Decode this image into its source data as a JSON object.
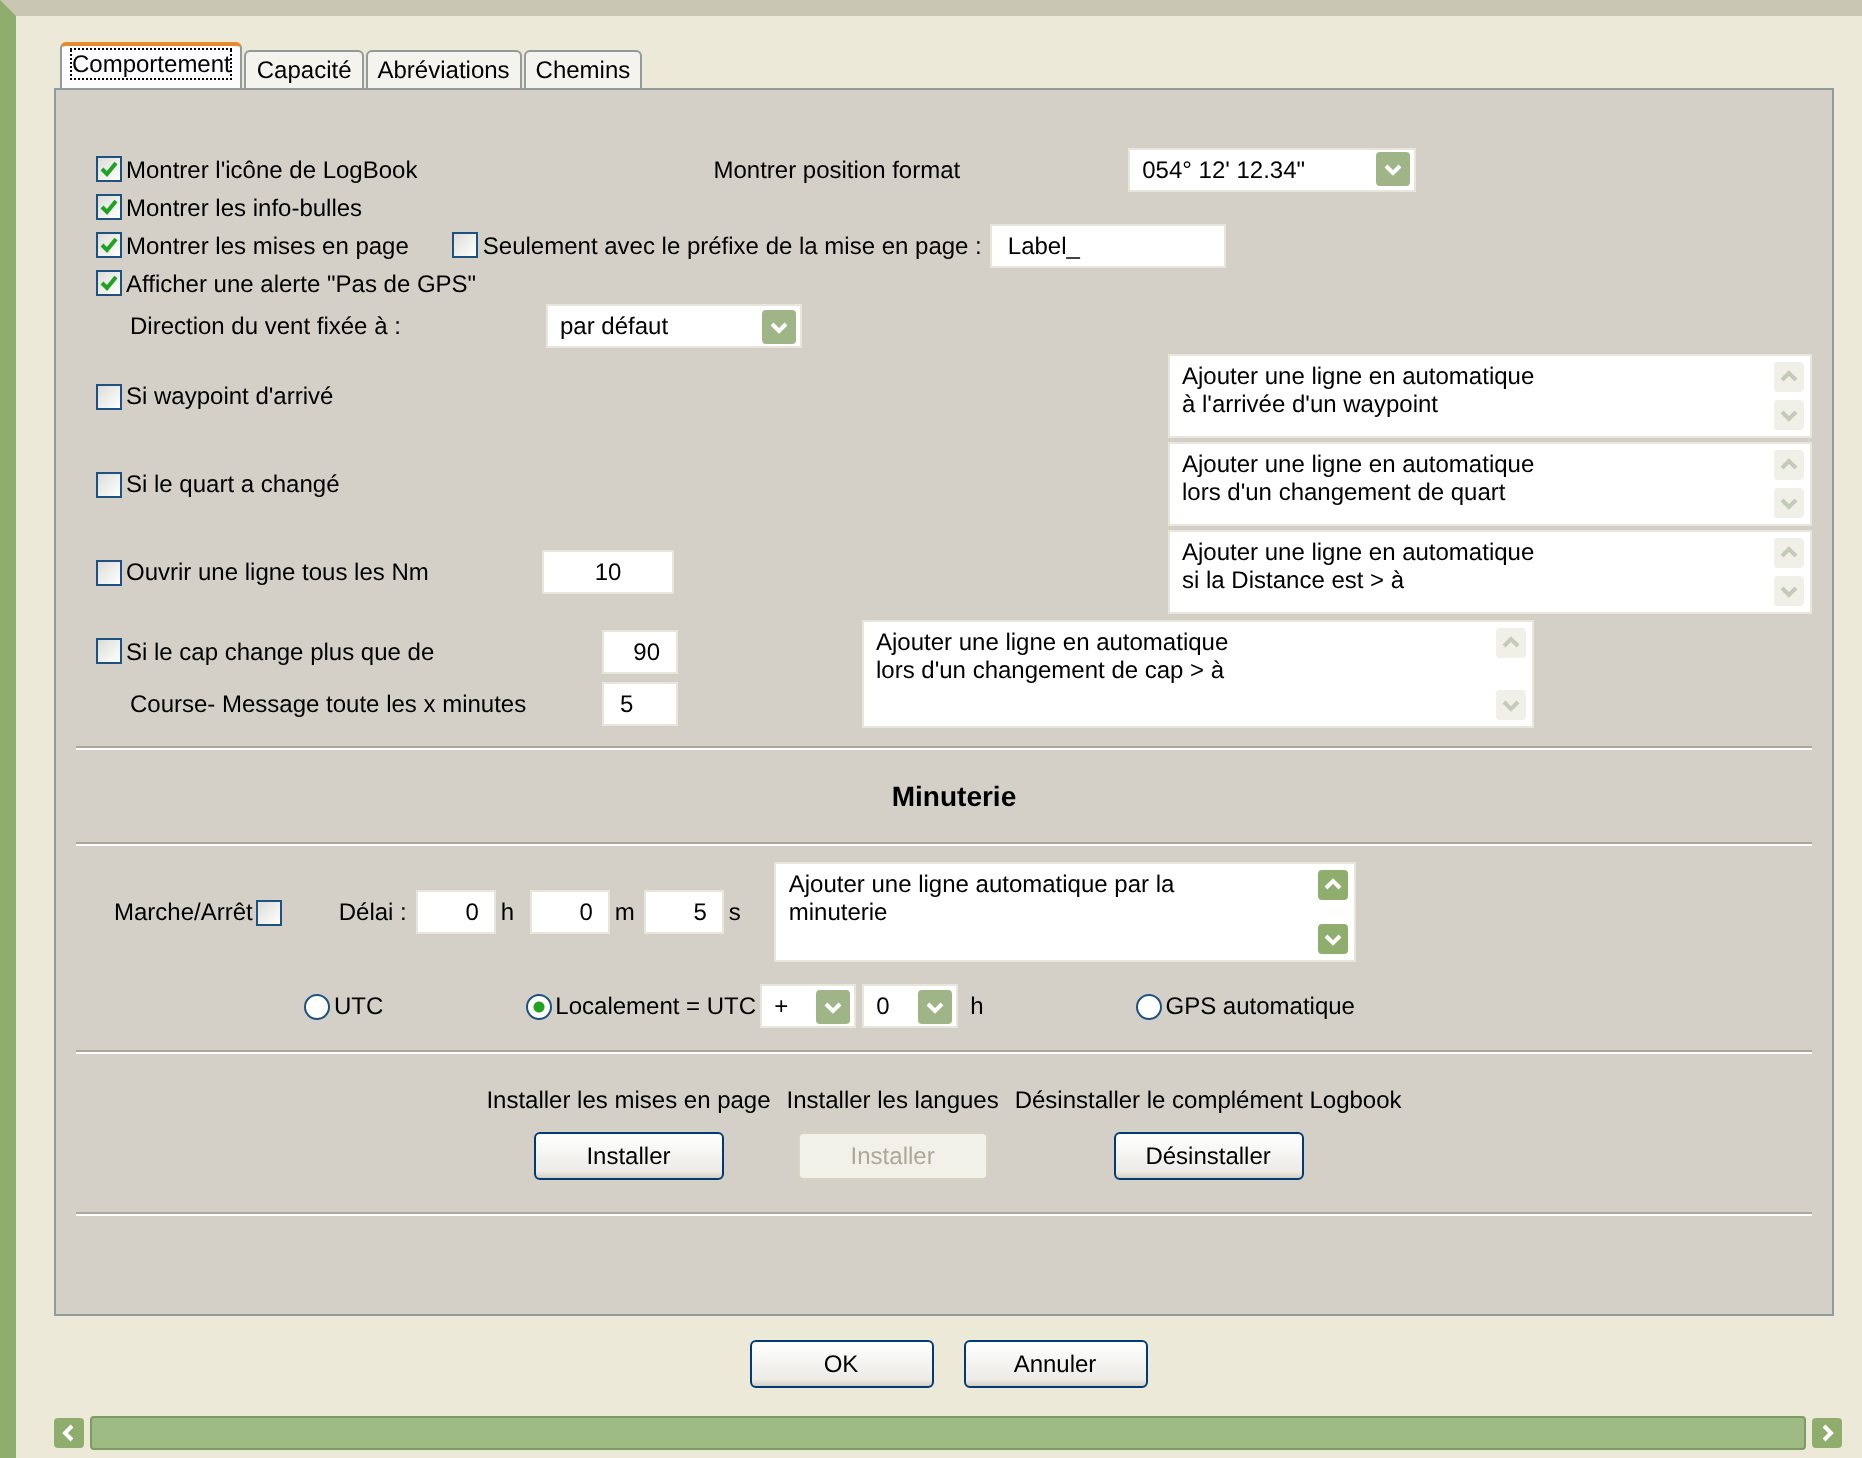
{
  "tabs": [
    {
      "label": "Comportement",
      "selected": true
    },
    {
      "label": "Capacité",
      "selected": false
    },
    {
      "label": "Abréviations",
      "selected": false
    },
    {
      "label": "Chemins",
      "selected": false
    }
  ],
  "options": [
    {
      "label": "Montrer l'icône de LogBook",
      "checked": true
    },
    {
      "label": "Montrer les info-bulles",
      "checked": true
    },
    {
      "label": "Montrer les mises en page",
      "checked": true
    },
    {
      "label": "Afficher une alerte \"Pas de GPS\"",
      "checked": true
    }
  ],
  "position_format": {
    "label": "Montrer position format",
    "value": "054° 12' 12.34\""
  },
  "prefix": {
    "label": "Seulement avec le préfixe de la mise en page :",
    "checked": false,
    "value": "Label_"
  },
  "wind": {
    "label": "Direction du vent fixée à :",
    "value": "par défaut"
  },
  "triggers": [
    {
      "label": "Si waypoint d'arrivé",
      "checked": false,
      "message": "Ajouter une ligne en automatique\nà l'arrivée d'un waypoint"
    },
    {
      "label": "Si le quart a changé",
      "checked": false,
      "message": "Ajouter une ligne en automatique\nlors d'un changement de quart"
    },
    {
      "label": "Ouvrir une ligne tous les Nm",
      "checked": false,
      "value": "10",
      "message": "Ajouter une ligne en automatique\nsi la Distance est > à"
    },
    {
      "label": "Si le cap change plus que de",
      "checked": false,
      "value": "90",
      "sub": {
        "label": "Course- Message toute les x minutes",
        "value": "5"
      },
      "message": "Ajouter une ligne en automatique\nlors d'un changement de cap > à"
    }
  ],
  "timer": {
    "title": "Minuterie",
    "toggle_label": "Marche/Arrêt",
    "on": false,
    "delay_label": "Délai :",
    "fields": [
      {
        "value": "0",
        "unit": "h"
      },
      {
        "value": "0",
        "unit": "m"
      },
      {
        "value": "5",
        "unit": "s"
      }
    ],
    "message": "Ajouter une ligne automatique par la\nminuterie"
  },
  "time_modes": [
    {
      "label": "UTC",
      "selected": false
    },
    {
      "label": "Localement = UTC",
      "selected": true,
      "offset": {
        "sign": "+",
        "hours": "0",
        "unit": "h"
      }
    },
    {
      "label": "GPS automatique",
      "selected": false
    }
  ],
  "install": [
    {
      "label": "Installer les mises en page",
      "button": "Installer",
      "disabled": false
    },
    {
      "label": "Installer les langues",
      "button": "Installer",
      "disabled": true
    },
    {
      "label": "Désinstaller le complément Logbook",
      "button": "Désinstaller",
      "disabled": false
    }
  ],
  "buttons": [
    "OK",
    "Annuler"
  ]
}
